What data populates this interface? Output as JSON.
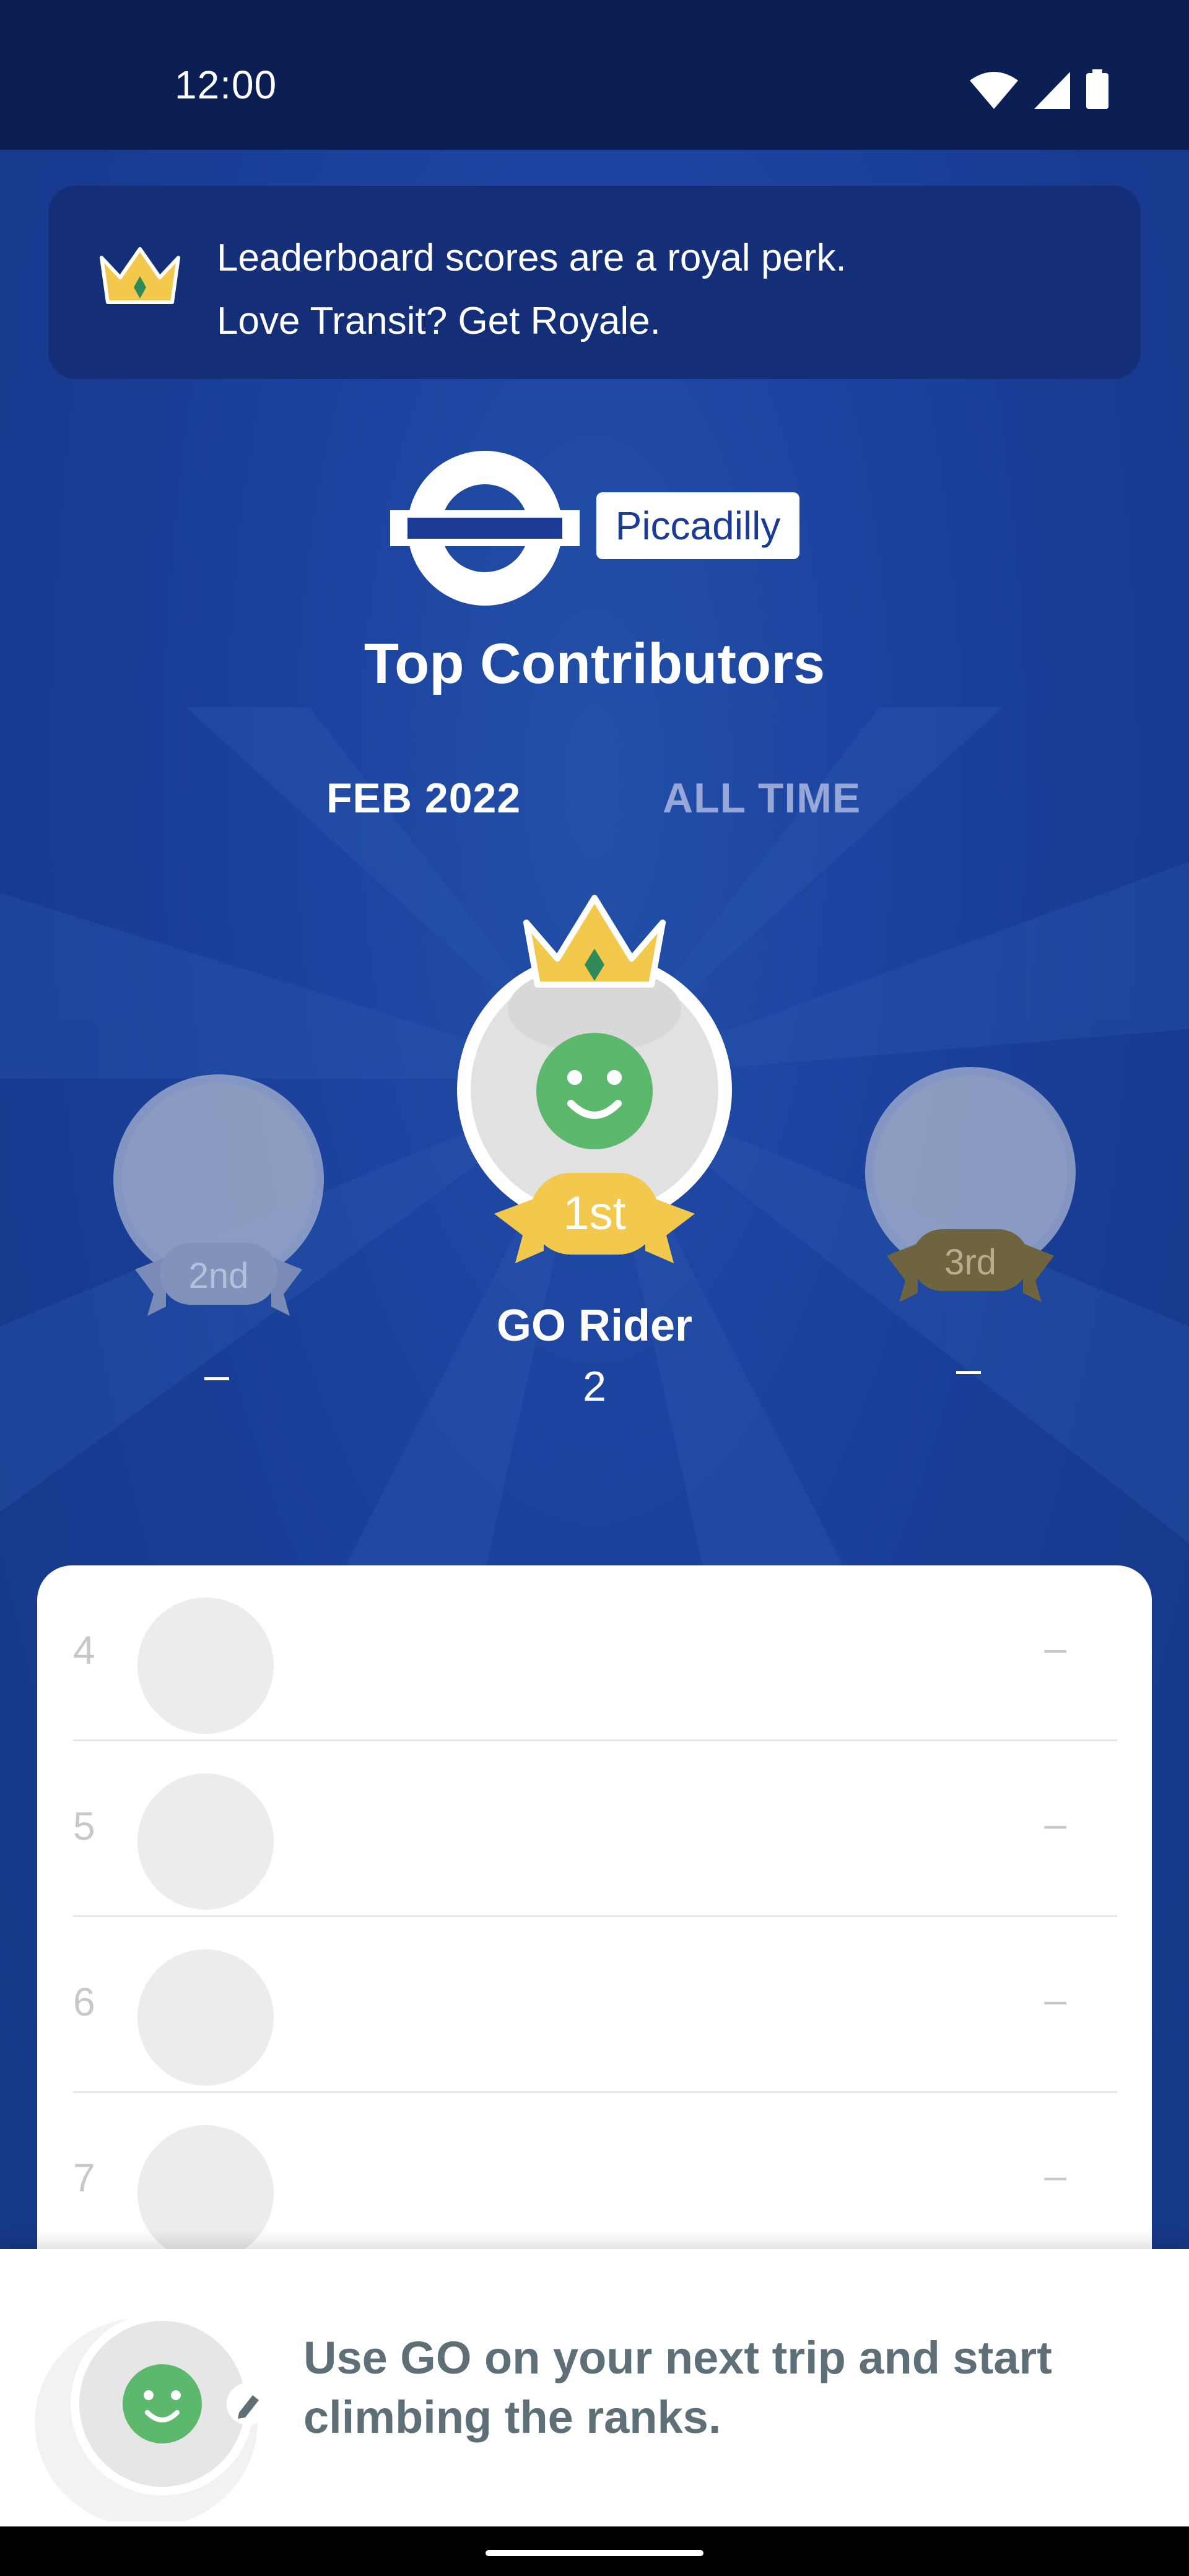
{
  "status_bar": {
    "time": "12:00"
  },
  "banner": {
    "line1": "Leaderboard scores are a royal perk.",
    "line2": "Love Transit? Get Royale.",
    "icon": "crown-icon"
  },
  "header": {
    "line_name": "Piccadilly",
    "title": "Top Contributors",
    "line_color": "#1b3b95"
  },
  "tabs": [
    {
      "label": "FEB 2022",
      "selected": true
    },
    {
      "label": "ALL TIME",
      "selected": false
    }
  ],
  "podium": {
    "first": {
      "rank_label": "1st",
      "name": "GO Rider",
      "score": "2"
    },
    "second": {
      "rank_label": "2nd",
      "score": "–"
    },
    "third": {
      "rank_label": "3rd",
      "score": "–"
    }
  },
  "leaderboard": {
    "rows": [
      {
        "rank": "4",
        "score": "–"
      },
      {
        "rank": "5",
        "score": "–"
      },
      {
        "rank": "6",
        "score": "–"
      },
      {
        "rank": "7",
        "score": "–"
      }
    ]
  },
  "cta": {
    "line1": "Use GO on your next trip and start",
    "line2": "climbing the ranks."
  },
  "colors": {
    "background": "#1b3b95",
    "banner": "#142f78",
    "gold": "#f2c94c",
    "bronze": "#6e6540",
    "avatar_green": "#5cb86c"
  }
}
